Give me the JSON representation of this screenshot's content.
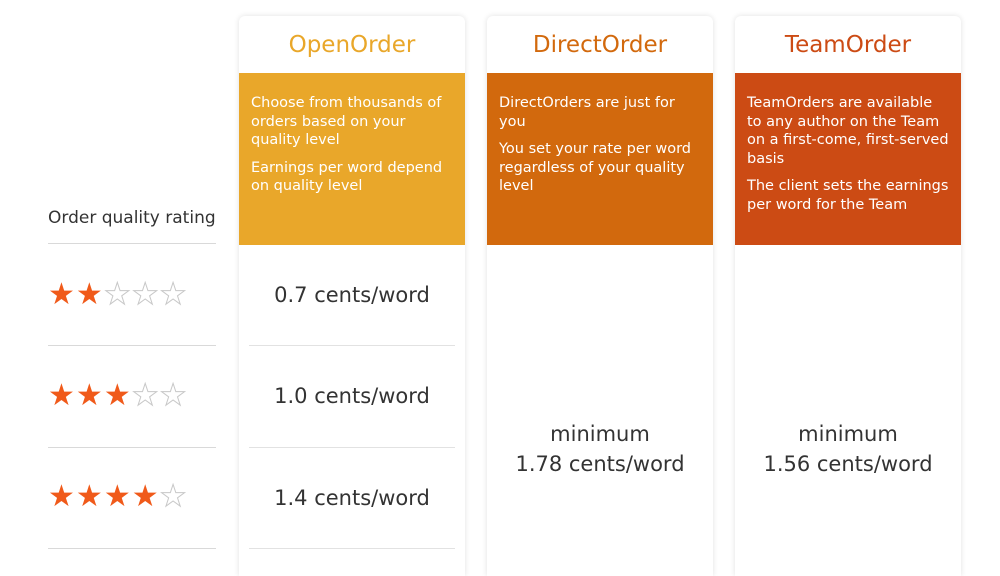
{
  "left": {
    "rating_header": "Order quality rating",
    "ratings": [
      {
        "stars": 2,
        "max": 5
      },
      {
        "stars": 3,
        "max": 5
      },
      {
        "stars": 4,
        "max": 5
      }
    ]
  },
  "colors": {
    "open": "#e9a72a",
    "direct": "#d2690d",
    "team": "#cc4b14",
    "star": "#f05a1a"
  },
  "cards": [
    {
      "title": "OpenOrder",
      "desc": [
        "Choose from thousands of orders based on your quality level",
        "Earnings per word depend on quality level"
      ],
      "prices": [
        "0.7 cents/word",
        "1.0 cents/word",
        "1.4 cents/word"
      ]
    },
    {
      "title": "DirectOrder",
      "desc": [
        "DirectOrders are just for you",
        "You set your rate per word regardless of your quality level"
      ],
      "price_label": "minimum",
      "price": "1.78 cents/word"
    },
    {
      "title": "TeamOrder",
      "desc": [
        "TeamOrders are available to any author on the Team on a first-come, first-served basis",
        "The client sets the earnings per word for the Team"
      ],
      "price_label": "minimum",
      "price": "1.56 cents/word"
    }
  ]
}
